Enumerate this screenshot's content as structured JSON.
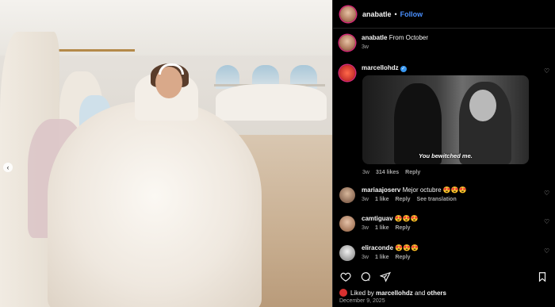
{
  "post_header": {
    "username": "anabatle",
    "separator": "•",
    "follow_label": "Follow"
  },
  "caption": {
    "username": "anabatle",
    "text": "From October",
    "time": "3w"
  },
  "comments": [
    {
      "username": "marcellohdz",
      "verified": true,
      "text": "",
      "time": "3w",
      "likes": "314 likes",
      "reply": "Reply",
      "translate": "",
      "gif_caption": "You bewitched me."
    },
    {
      "username": "mariaajoserv",
      "verified": false,
      "text": "Mejor octubre 😍😍😍",
      "time": "3w",
      "likes": "1 like",
      "reply": "Reply",
      "translate": "See translation"
    },
    {
      "username": "camtiguav",
      "verified": false,
      "text": "😍😍😍",
      "time": "3w",
      "likes": "1 like",
      "reply": "Reply",
      "translate": ""
    },
    {
      "username": "eliraconde",
      "verified": false,
      "text": "😍😍😍",
      "time": "3w",
      "likes": "1 like",
      "reply": "Reply",
      "translate": ""
    }
  ],
  "liked_by": {
    "prefix": "Liked by",
    "user": "marcellohdz",
    "and": "and",
    "others": "others"
  },
  "post_date": "December 9, 2025",
  "icons": {
    "like": "heart-icon",
    "comment": "comment-icon",
    "share": "send-icon",
    "save": "bookmark-icon",
    "carousel": "chevron-left-icon"
  },
  "colors": {
    "follow": "#4a90ff",
    "verified": "#3897f0",
    "muted": "#a8a8a8",
    "background": "#000000"
  }
}
